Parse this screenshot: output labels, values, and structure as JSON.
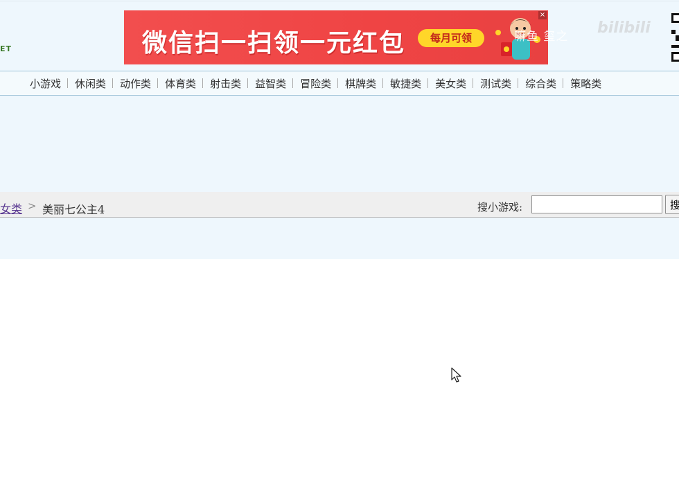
{
  "header": {
    "logo_fragment": "ET",
    "banner": {
      "text": "微信扫一扫领一元红包",
      "pill": "每月可领",
      "close": "×"
    },
    "watermark": "嘛鱼 玺之",
    "watermark_logo": "bilibili"
  },
  "nav": {
    "items": [
      "小游戏",
      "休闲类",
      "动作类",
      "体育类",
      "射击类",
      "益智类",
      "冒险类",
      "棋牌类",
      "敏捷类",
      "美女类",
      "测试类",
      "综合类",
      "策略类"
    ]
  },
  "breadcrumb": {
    "parent": "女类",
    "separator": ">",
    "current": "美丽七公主4"
  },
  "search": {
    "label": "搜小游戏:",
    "value": "",
    "button": "搜"
  },
  "colors": {
    "page_band": "#eef7fd",
    "banner_red": "#ef4444",
    "pill_yellow": "#ffd629",
    "link_purple": "#5b3a92"
  }
}
